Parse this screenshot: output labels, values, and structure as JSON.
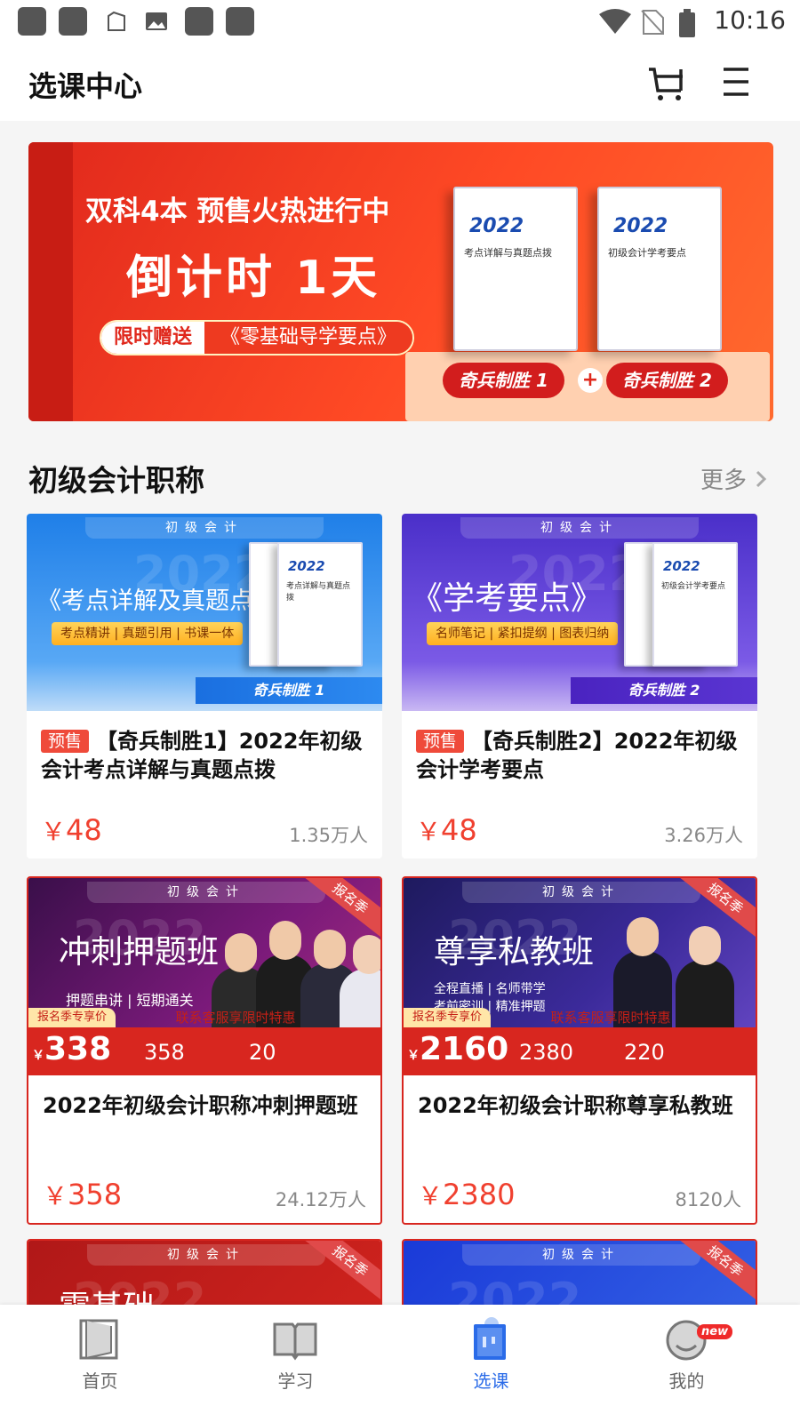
{
  "status_bar": {
    "time": "10:16"
  },
  "header": {
    "title": "选课中心"
  },
  "banner": {
    "line1": "双科4本 预售火热进行中",
    "line2": "倒计时 1天",
    "gift_tag": "限时赠送",
    "gift_text": "《零基础导学要点》",
    "book1_year": "2022",
    "book1_title": "考点详解与真题点拨",
    "book2_year": "2022",
    "book2_title": "初级会计学考要点",
    "pill1": "奇兵制胜 1",
    "pill2": "奇兵制胜 2",
    "plus": "+"
  },
  "section": {
    "title": "初级会计职称",
    "more": "更多"
  },
  "cards": [
    {
      "ribbon": "初级会计",
      "ghost": "2022",
      "headline": "《考点详解及真题点拨》",
      "features": "考点精讲 | 真题引用 | 书课一体",
      "platform": "奇兵制胜 1",
      "book_year": "2022",
      "book_title": "考点详解与真题点拨",
      "badge": "预售",
      "title": "【奇兵制胜1】2022年初级会计考点详解与真题点拨",
      "price_symbol": "￥",
      "price": "48",
      "learners": "1.35万人"
    },
    {
      "ribbon": "初级会计",
      "ghost": "2022",
      "headline": "《学考要点》",
      "features": "名师笔记 | 紧扣提纲 | 图表归纳",
      "platform": "奇兵制胜 2",
      "book_year": "2022",
      "book_title": "初级会计学考要点",
      "badge": "预售",
      "title": "【奇兵制胜2】2022年初级会计学考要点",
      "price_symbol": "￥",
      "price": "48",
      "learners": "3.26万人"
    },
    {
      "ribbon": "初级会计",
      "ghost": "2022",
      "headline": "冲刺押题班",
      "sub": "押题串讲 | 短期通关",
      "corner": "报名季",
      "tagline": "报名季专享价",
      "promo": "联系客服享限时特惠",
      "bar_price_symbol": "￥",
      "bar_price": "338",
      "orig": "358",
      "save": "20",
      "title": "2022年初级会计职称冲刺押题班",
      "price_symbol": "￥",
      "price": "358",
      "learners": "24.12万人"
    },
    {
      "ribbon": "初级会计",
      "ghost": "2022",
      "headline": "尊享私教班",
      "sub": "全程直播 | 名师带学",
      "sub2": "考前密训 | 精准押题",
      "corner": "报名季",
      "tagline": "报名季专享价",
      "promo": "联系客服享限时特惠",
      "bar_price_symbol": "￥",
      "bar_price": "2160",
      "orig": "2380",
      "save": "220",
      "title": "2022年初级会计职称尊享私教班",
      "price_symbol": "￥",
      "price": "2380",
      "learners": "8120人"
    },
    {
      "ribbon": "初级会计",
      "ghost": "2022",
      "headline": "零基础",
      "corner": "报名季"
    },
    {
      "ribbon": "初级会计",
      "ghost": "2022",
      "corner": "报名季"
    }
  ],
  "tabs": [
    {
      "label": "首页",
      "icon": "home-book-icon"
    },
    {
      "label": "学习",
      "icon": "open-book-icon"
    },
    {
      "label": "选课",
      "icon": "course-select-icon"
    },
    {
      "label": "我的",
      "icon": "smiley-profile-icon",
      "badge": "new"
    }
  ],
  "colors": {
    "accent": "#2a6be8",
    "price": "#f0402f",
    "banner": "#e0281c"
  }
}
